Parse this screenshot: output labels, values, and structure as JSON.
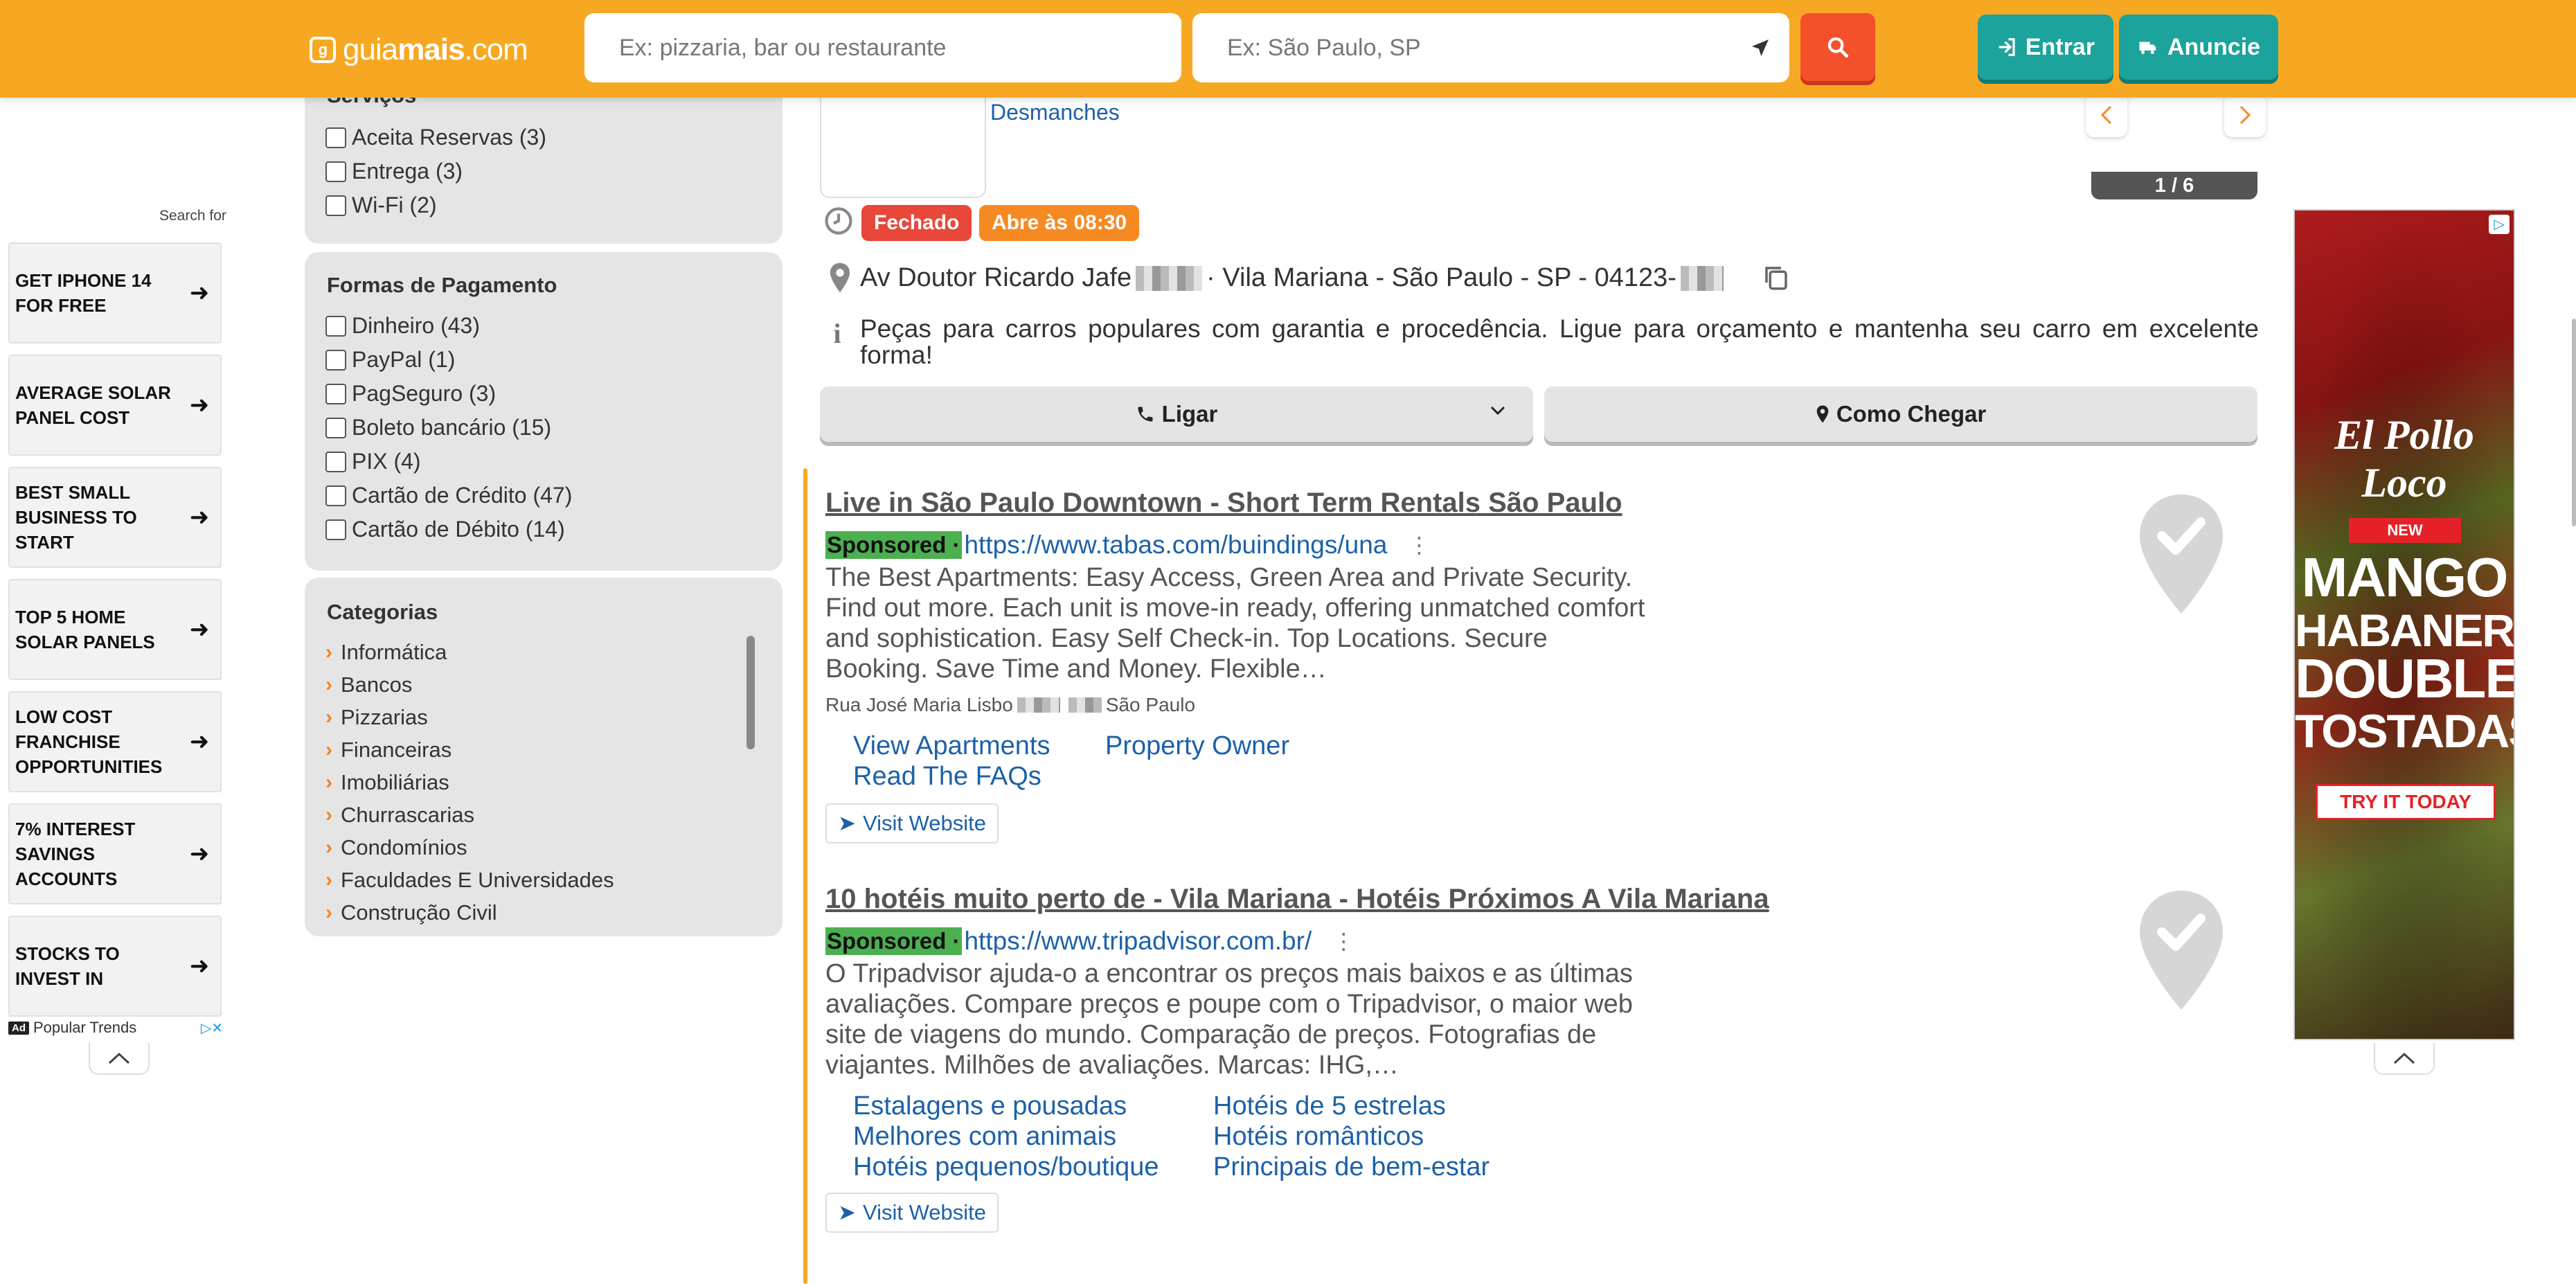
{
  "header": {
    "logo_text_a": "guia",
    "logo_text_b": "mais",
    "logo_text_c": ".com",
    "search_what_placeholder": "Ex: pizzaria, bar ou restaurante",
    "search_where_placeholder": "Ex: São Paulo, SP",
    "entrar_label": "Entrar",
    "anuncie_label": "Anuncie",
    "colors": {
      "bar": "#f7a823",
      "search_btn": "#f4502b",
      "teal": "#1ba39c"
    }
  },
  "left_ad": {
    "search_for": "Search for",
    "items": [
      "GET IPHONE 14 FOR FREE",
      "AVERAGE SOLAR PANEL COST",
      "BEST SMALL BUSINESS TO START",
      "TOP 5 HOME SOLAR PANELS",
      "LOW COST FRANCHISE OPPORTUNITIES",
      "7% INTEREST SAVINGS ACCOUNTS",
      "STOCKS TO INVEST IN"
    ],
    "ad_label": "Ad",
    "footer": "Popular Trends"
  },
  "filters": {
    "servicos": {
      "title": "Serviços",
      "options": [
        "Aceita Reservas (3)",
        "Entrega (3)",
        "Wi-Fi (2)"
      ]
    },
    "pagamento": {
      "title": "Formas de Pagamento",
      "options": [
        "Dinheiro (43)",
        "PayPal (1)",
        "PagSeguro (3)",
        "Boleto bancário (15)",
        "PIX (4)",
        "Cartão de Crédito (47)",
        "Cartão de Débito (14)"
      ]
    },
    "categorias": {
      "title": "Categorias",
      "items": [
        "Informática",
        "Bancos",
        "Pizzarias",
        "Financeiras",
        "Imobiliárias",
        "Churrascarias",
        "Condomínios",
        "Faculdades E Universidades",
        "Construção Civil"
      ]
    }
  },
  "listing": {
    "category_link": "Desmanches",
    "carousel_counter": "1 / 6",
    "status_closed": "Fechado",
    "status_opens": "Abre às 08:30",
    "address_a": "Av Doutor Ricardo Jafe",
    "address_b": " · Vila Mariana - São Paulo - SP - 04123-",
    "description": "Peças para carros populares com garantia e procedência. Ligue para orçamento e mantenha seu carro em excelente forma!",
    "call_label": "Ligar",
    "directions_label": "Como Chegar"
  },
  "sponsored": [
    {
      "title": "Live in São Paulo Downtown - Short Term Rentals São Paulo",
      "label": "Sponsored ·",
      "url": "https://www.tabas.com/buindings/una",
      "description": "The Best Apartments: Easy Access, Green Area and Private Security. Find out more. Each unit is move-in ready, offering unmatched comfort and sophistication. Easy Self Check-in. Top Locations. Secure Booking. Save Time and Money. Flexible…",
      "address_a": "Rua José Maria Lisbo",
      "address_b": "São Paulo",
      "sitelinks": [
        "View Apartments",
        "Property Owner",
        "Read The FAQs"
      ],
      "visit_label": "Visit Website"
    },
    {
      "title": "10 hotéis muito perto de - Vila Mariana - Hotéis Próximos A Vila Mariana",
      "label": "Sponsored ·",
      "url": "https://www.tripadvisor.com.br/",
      "description": "O Tripadvisor ajuda-o a encontrar os preços mais baixos e as últimas avaliações. Compare preços e poupe com o Tripadvisor, o maior web site de viagens do mundo. Comparação de preços. Fotografias de viajantes. Milhões de avaliações. Marcas: IHG,…",
      "sitelinks": [
        "Estalagens e pousadas",
        "Hotéis de 5 estrelas",
        "Melhores com animais",
        "Hotéis românticos",
        "Hotéis pequenos/boutique",
        "Principais de bem-estar"
      ],
      "visit_label": "Visit Website"
    }
  ],
  "right_ad": {
    "brand": "El Pollo Loco",
    "new_label": "NEW",
    "headline": [
      "MANGO",
      "HABANERO",
      "DOUBLE",
      "TOSTADAS"
    ],
    "cta": "TRY IT TODAY"
  }
}
